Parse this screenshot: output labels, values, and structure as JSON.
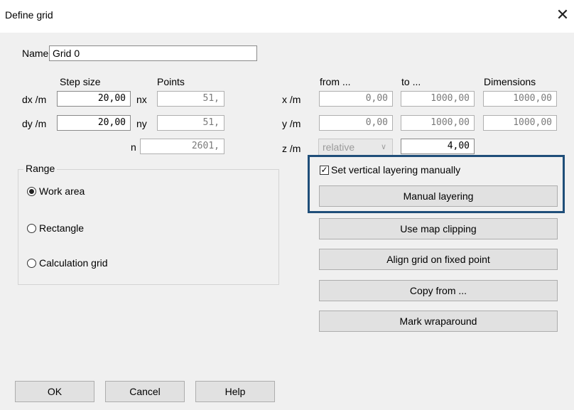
{
  "window": {
    "title": "Define grid",
    "close_glyph": "✕"
  },
  "name": {
    "label": "Name",
    "value": "Grid 0"
  },
  "headers": {
    "step_size": "Step size",
    "points": "Points",
    "from": "from ...",
    "to": "to ...",
    "dimensions": "Dimensions"
  },
  "rows": {
    "dx": {
      "label": "dx /m",
      "step": "20,00",
      "pts_label": "nx",
      "pts": "51,"
    },
    "dy": {
      "label": "dy /m",
      "step": "20,00",
      "pts_label": "ny",
      "pts": "51,"
    },
    "n": {
      "label": "n",
      "value": "2601,"
    }
  },
  "coords": {
    "x": {
      "label": "x /m",
      "from": "0,00",
      "to": "1000,00",
      "dim": "1000,00"
    },
    "y": {
      "label": "y /m",
      "from": "0,00",
      "to": "1000,00",
      "dim": "1000,00"
    },
    "z": {
      "label": "z /m",
      "mode": "relative",
      "to": "4,00"
    }
  },
  "range": {
    "title": "Range",
    "options": [
      "Work area",
      "Rectangle",
      "Calculation grid"
    ],
    "selected": "Work area"
  },
  "layering": {
    "checkbox_label": "Set vertical layering manually",
    "checked": true,
    "button": "Manual layering"
  },
  "buttons": {
    "map_clipping": "Use map clipping",
    "align": "Align grid on fixed point",
    "copy": "Copy from ...",
    "wrap": "Mark wraparound",
    "ok": "OK",
    "cancel": "Cancel",
    "help": "Help"
  },
  "colors": {
    "highlight": "#1f4e79",
    "dialog_bg": "#f0f0f0",
    "button_bg": "#e1e1e1"
  }
}
